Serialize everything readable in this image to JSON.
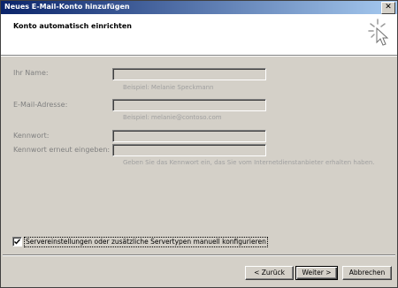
{
  "window": {
    "title": "Neues E-Mail-Konto hinzufügen",
    "close_glyph": "✕"
  },
  "header": {
    "heading": "Konto automatisch einrichten"
  },
  "form": {
    "name": {
      "label": "Ihr Name:",
      "value": "",
      "hint": "Beispiel: Melanie Speckmann"
    },
    "email": {
      "label": "E-Mail-Adresse:",
      "value": "",
      "hint": "Beispiel: melanie@contoso.com"
    },
    "password": {
      "label": "Kennwort:",
      "value": ""
    },
    "password_confirm": {
      "label": "Kennwort erneut eingeben:",
      "value": ""
    },
    "password_hint": "Geben Sie das Kennwort ein, das Sie vom Internetdienstanbieter erhalten haben."
  },
  "manual_config": {
    "label": "Servereinstellungen oder zusätzliche Servertypen manuell konfigurieren",
    "checked": true
  },
  "buttons": {
    "back": "< Zurück",
    "next": "Weiter >",
    "cancel": "Abbrechen"
  }
}
